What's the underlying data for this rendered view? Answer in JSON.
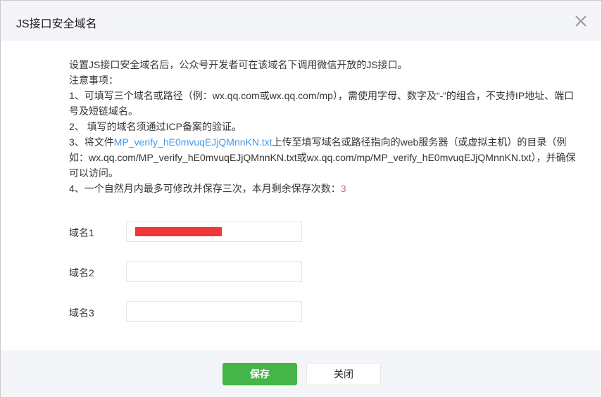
{
  "dialog": {
    "title": "JS接口安全域名",
    "close_icon": "close-icon"
  },
  "content": {
    "intro": "设置JS接口安全域名后，公众号开发者可在该域名下调用微信开放的JS接口。",
    "notes_title": "注意事项：",
    "note1": "1、可填写三个域名或路径（例：wx.qq.com或wx.qq.com/mp），需使用字母、数字及“-”的组合，不支持IP地址、端口号及短链域名。",
    "note2": "2、 填写的域名须通过ICP备案的验证。",
    "note3_prefix": "3、将文件",
    "note3_link": "MP_verify_hE0mvuqEJjQMnnKN.txt",
    "note3_suffix": "上传至填写域名或路径指向的web服务器（或虚拟主机）的目录（例如：wx.qq.com/MP_verify_hE0mvuqEJjQMnnKN.txt或wx.qq.com/mp/MP_verify_hE0mvuqEJjQMnnKN.txt），并确保可以访问。",
    "note4_prefix": "4、一个自然月内最多可修改并保存三次，本月剩余保存次数：",
    "note4_count": "3"
  },
  "form": {
    "fields": [
      {
        "label": "域名1",
        "value": ""
      },
      {
        "label": "域名2",
        "value": ""
      },
      {
        "label": "域名3",
        "value": ""
      }
    ]
  },
  "footer": {
    "save_label": "保存",
    "close_label": "关闭"
  },
  "colors": {
    "primary": "#44b549",
    "link": "#459ae9",
    "highlight": "#e15f63",
    "header_bg": "#f4f5f9"
  }
}
